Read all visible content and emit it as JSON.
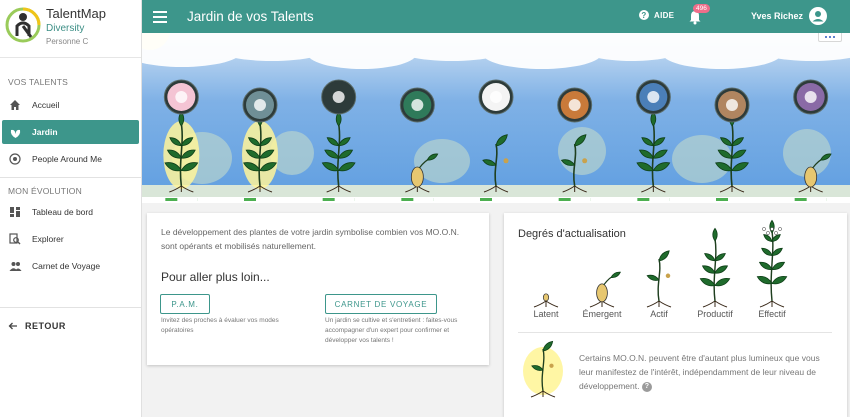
{
  "brand": {
    "title": "TalentMap",
    "subtitle": "Diversity",
    "user": "Personne C"
  },
  "sidebar": {
    "section1": "VOS TALENTS",
    "section2": "MON ÉVOLUTION",
    "items": [
      {
        "label": "Accueil",
        "icon": "home-icon"
      },
      {
        "label": "Jardin",
        "icon": "garden-icon",
        "active": true
      },
      {
        "label": "People Around Me",
        "icon": "target-icon"
      },
      {
        "label": "Tableau de bord",
        "icon": "dashboard-icon"
      },
      {
        "label": "Explorer",
        "icon": "explore-icon"
      },
      {
        "label": "Carnet de Voyage",
        "icon": "people-icon"
      }
    ],
    "back": "RETOUR"
  },
  "topbar": {
    "title": "Jardin de vos Talents",
    "help": "AIDE",
    "notifications": "496",
    "user": "Yves Richez"
  },
  "colors": {
    "primary": "#3d968b",
    "badge": "#ee6e8a",
    "glow": "#fff59a"
  },
  "garden": {
    "plants": [
      {
        "stage": "productif",
        "glow": true,
        "talent_icon": "flower-icon"
      },
      {
        "stage": "productif",
        "glow": true,
        "talent_icon": "group-icon"
      },
      {
        "stage": "productif",
        "glow": false,
        "talent_icon": "bulb-icon"
      },
      {
        "stage": "emergent",
        "glow": false,
        "talent_icon": "pi-icon"
      },
      {
        "stage": "actif",
        "glow": false,
        "talent_icon": "cube-icon"
      },
      {
        "stage": "actif",
        "glow": false,
        "talent_icon": "leaf-icon"
      },
      {
        "stage": "productif",
        "glow": false,
        "talent_icon": "person-icon"
      },
      {
        "stage": "productif",
        "glow": false,
        "talent_icon": "tools-icon"
      },
      {
        "stage": "emergent",
        "glow": false,
        "talent_icon": "gears-icon"
      }
    ]
  },
  "info": {
    "intro": "Le développement des plantes de votre jardin symbolise combien vos MO.O.N. sont opérants et mobilisés naturellement.",
    "further": "Pour aller plus loin...",
    "pam_button": "P.A.M.",
    "pam_hint": "Invitez des proches à évaluer vos modes opératoires",
    "cv_button": "CARNET DE VOYAGE",
    "cv_hint": "Un jardin se cultive et s'entretient : faites-vous accompagner d'un expert pour confirmer et développer vos talents !"
  },
  "degrees": {
    "title": "Degrés d'actualisation",
    "stages": [
      "Latent",
      "Émergent",
      "Actif",
      "Productif",
      "Effectif"
    ],
    "note": "Certains MO.O.N. peuvent être d'autant plus lumineux que vous leur manifestez de l'intérêt, indépendamment de leur niveau de développement."
  }
}
